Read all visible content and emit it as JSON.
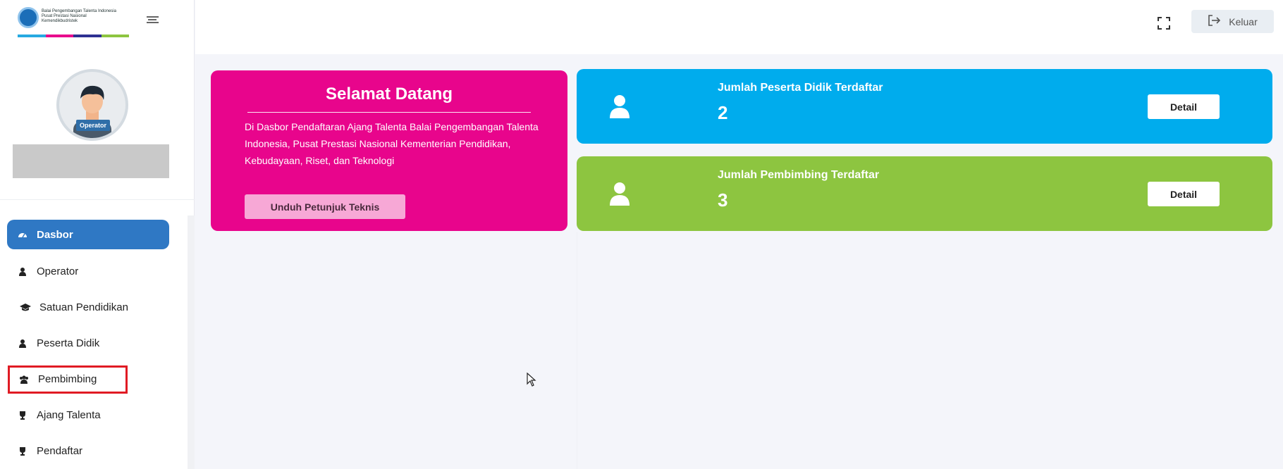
{
  "logo": {
    "text_lines": [
      "Balai Pengembangan Talenta Indonesia",
      "Pusat Prestasi Nasional",
      "Kemendikbudristek"
    ],
    "stripe_colors": [
      "#27a9e1",
      "#e8058c",
      "#2e3192",
      "#8dc540"
    ]
  },
  "profile": {
    "role_badge": "Operator"
  },
  "menu": {
    "items": [
      {
        "label": "Dasbor",
        "icon": "dashboard-icon",
        "active": true
      },
      {
        "label": "Operator",
        "icon": "user-icon"
      },
      {
        "label": "Satuan Pendidikan",
        "icon": "graduation-cap-icon"
      },
      {
        "label": "Peserta Didik",
        "icon": "user-icon"
      },
      {
        "label": "Pembimbing",
        "icon": "users-icon",
        "highlighted": true
      },
      {
        "label": "Ajang Talenta",
        "icon": "trophy-icon"
      },
      {
        "label": "Pendaftar",
        "icon": "trophy-icon"
      }
    ]
  },
  "topbar": {
    "logout_label": "Keluar"
  },
  "welcome": {
    "title": "Selamat Datang",
    "description": "Di Dasbor Pendaftaran Ajang Talenta Balai Pengembangan Talenta Indonesia, Pusat Prestasi Nasional Kementerian Pendidikan, Kebudayaan, Riset, dan Teknologi",
    "button_label": "Unduh Petunjuk Teknis"
  },
  "stats": [
    {
      "label": "Jumlah Peserta Didik Terdaftar",
      "value": "2",
      "button_label": "Detail",
      "color": "#00aced"
    },
    {
      "label": "Jumlah Pembimbing Terdaftar",
      "value": "3",
      "button_label": "Detail",
      "color": "#8dc540"
    }
  ],
  "colors": {
    "accent_blue": "#2f78c4",
    "welcome_pink": "#e8058c",
    "highlight_red": "#e01b24"
  }
}
